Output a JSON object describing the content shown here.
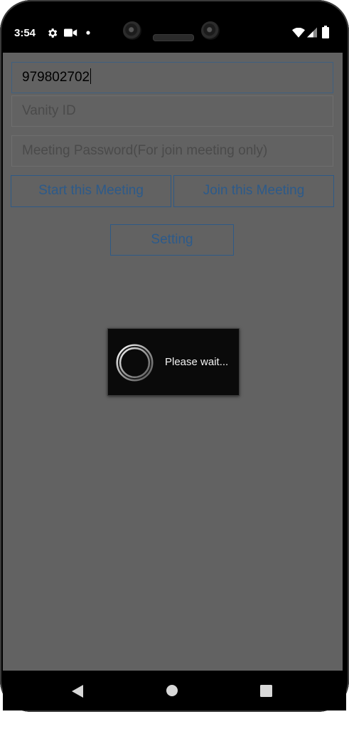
{
  "status_bar": {
    "time": "3:54",
    "left_icons": [
      "gear-icon",
      "video-camera-icon",
      "dot-icon"
    ],
    "right_icons": [
      "wifi-icon",
      "signal-icon",
      "battery-icon"
    ]
  },
  "form": {
    "meeting_id_value": "979802702",
    "vanity_id_placeholder": "Vanity ID",
    "password_placeholder": "Meeting Password(For join meeting only)"
  },
  "buttons": {
    "start_label": "Start this Meeting",
    "join_label": "Join this Meeting",
    "setting_label": "Setting"
  },
  "dialog": {
    "message": "Please wait..."
  },
  "nav_bar": {
    "icons": [
      "back-icon",
      "home-icon",
      "recents-icon"
    ]
  },
  "colors": {
    "screen_dim": "#626262",
    "button_text": "#2c5a8a",
    "dialog_bg": "#0a0a0a"
  }
}
